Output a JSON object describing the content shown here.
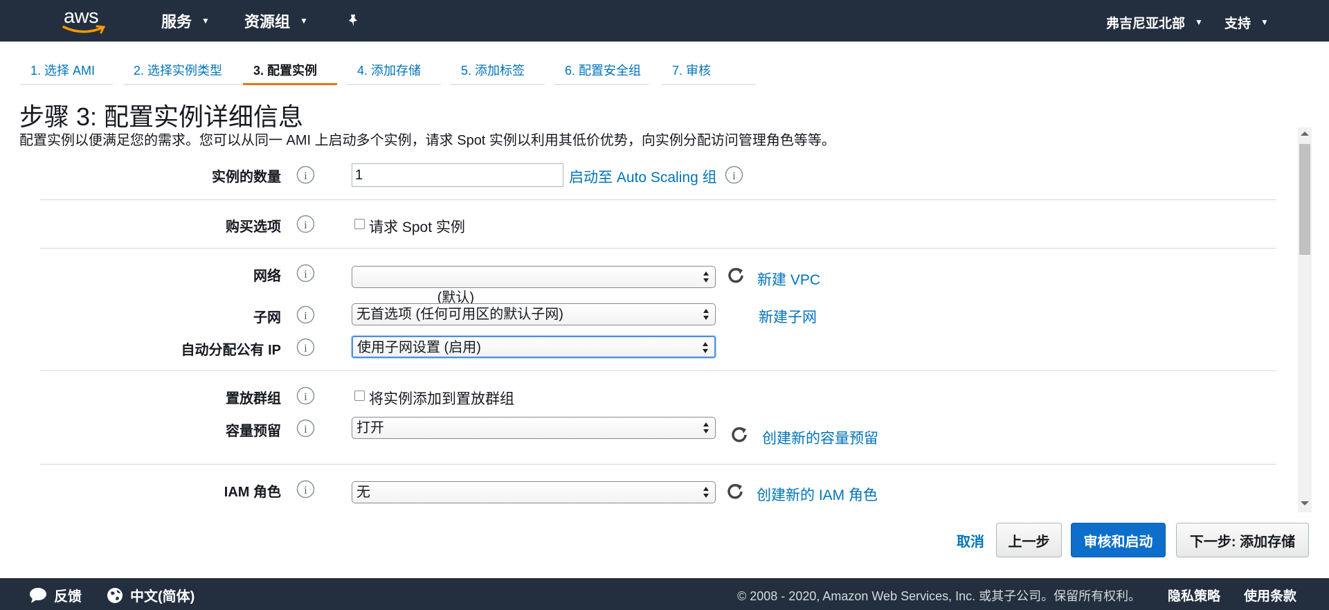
{
  "nav": {
    "logo_text": "aws",
    "services": "服务",
    "resource_groups": "资源组",
    "region": "弗吉尼亚北部",
    "support": "支持",
    "pin_icon": "pushpin-icon"
  },
  "tabs": [
    {
      "label": "1. 选择 AMI"
    },
    {
      "label": "2. 选择实例类型"
    },
    {
      "label": "3. 配置实例"
    },
    {
      "label": "4. 添加存储"
    },
    {
      "label": "5. 添加标签"
    },
    {
      "label": "6. 配置安全组"
    },
    {
      "label": "7. 审核"
    }
  ],
  "active_tab": 2,
  "page": {
    "title": "步骤 3: 配置实例详细信息",
    "description": "配置实例以便满足您的需求。您可以从同一 AMI 上启动多个实例，请求 Spot 实例以利用其低价优势，向实例分配访问管理角色等等。"
  },
  "form": {
    "instance_count": {
      "label": "实例的数量",
      "value": "1",
      "link": "启动至 Auto Scaling 组"
    },
    "purchase": {
      "label": "购买选项",
      "checkbox": "请求 Spot 实例",
      "checked": false
    },
    "network": {
      "label": "网络",
      "value": "                 (默认)",
      "link": "新建 VPC"
    },
    "subnet": {
      "label": "子网",
      "value": "无首选项 (任何可用区的默认子网)",
      "link": "新建子网"
    },
    "public_ip": {
      "label": "自动分配公有 IP",
      "value": "使用子网设置 (启用)"
    },
    "placement": {
      "label": "置放群组",
      "checkbox": "将实例添加到置放群组",
      "checked": false
    },
    "capacity": {
      "label": "容量预留",
      "value": "打开",
      "link": "创建新的容量预留"
    },
    "iam": {
      "label": "IAM 角色",
      "value": "无",
      "link": "创建新的 IAM 角色"
    }
  },
  "actions": {
    "cancel": "取消",
    "previous": "上一步",
    "review_launch": "审核和启动",
    "next": "下一步: 添加存储"
  },
  "footer": {
    "feedback": "反馈",
    "language": "中文(简体)",
    "copyright": "© 2008 - 2020, Amazon Web Services, Inc. 或其子公司。保留所有权利。",
    "privacy": "隐私策略",
    "terms": "使用条款"
  },
  "colors": {
    "nav_bg": "#232f3e",
    "link": "#0073bb",
    "accent": "#ec7211",
    "primary_button": "#0d6fcb"
  }
}
